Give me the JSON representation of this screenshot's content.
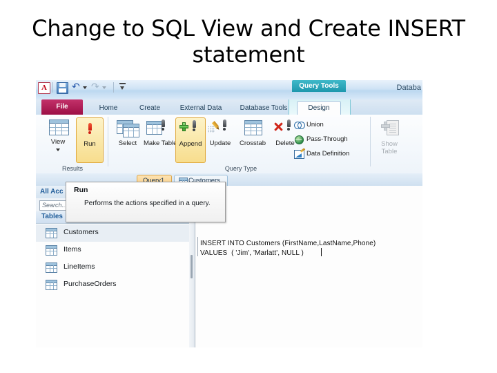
{
  "slide": {
    "title": "Change to SQL View and Create INSERT statement"
  },
  "app": {
    "window_title": "Databa",
    "logo_letter": "A",
    "contextual_group": "Query Tools",
    "quick_access": [
      {
        "name": "save-icon",
        "label": "Save"
      },
      {
        "name": "undo-icon",
        "label": "Undo"
      },
      {
        "name": "redo-icon",
        "label": "Redo"
      },
      {
        "name": "customize-qat-icon",
        "label": "Customize Quick Access Toolbar"
      }
    ]
  },
  "tabs": {
    "file": "File",
    "items": [
      "Home",
      "Create",
      "External Data",
      "Database Tools"
    ],
    "contextual": "Design"
  },
  "ribbon": {
    "groups": [
      {
        "label": "Results"
      },
      {
        "label": "Query Type"
      }
    ],
    "results": [
      {
        "label": "View",
        "icon": "datasheet-icon",
        "highlighted": false,
        "has_dropdown": true
      },
      {
        "label": "Run",
        "icon": "run-exclamation-icon",
        "highlighted": true,
        "has_dropdown": false
      }
    ],
    "query_type": [
      {
        "label": "Select",
        "icon": "select-query-icon",
        "highlighted": false
      },
      {
        "label": "Make Table",
        "icon": "make-table-query-icon",
        "highlighted": false
      },
      {
        "label": "Append",
        "icon": "append-query-icon",
        "highlighted": true
      },
      {
        "label": "Update",
        "icon": "update-query-icon",
        "highlighted": false
      },
      {
        "label": "Crosstab",
        "icon": "crosstab-query-icon",
        "highlighted": false
      },
      {
        "label": "Delete",
        "icon": "delete-query-icon",
        "highlighted": false
      }
    ],
    "query_type_menu": [
      {
        "label": "Union",
        "icon": "union-icon"
      },
      {
        "label": "Pass-Through",
        "icon": "globe-icon"
      },
      {
        "label": "Data Definition",
        "icon": "data-definition-icon"
      }
    ],
    "show_table": {
      "label_line1": "Show",
      "label_line2": "Table",
      "icon": "show-table-icon",
      "disabled": true
    }
  },
  "tooltip": {
    "title": "Run",
    "body": "Performs the actions specified in a query."
  },
  "document_tabs": [
    {
      "label": "Query1",
      "active": true,
      "icon": null
    },
    {
      "label": "Customers",
      "active": false,
      "icon": "table-icon"
    }
  ],
  "nav_pane": {
    "header": "All Acc",
    "search_placeholder": "Search...",
    "group_header": "Tables",
    "items": [
      {
        "label": "Customers",
        "icon": "table-icon",
        "selected": true
      },
      {
        "label": "Items",
        "icon": "table-icon",
        "selected": false
      },
      {
        "label": "LineItems",
        "icon": "table-icon",
        "selected": false
      },
      {
        "label": "PurchaseOrders",
        "icon": "table-icon",
        "selected": false
      }
    ]
  },
  "sql_pane": {
    "text": "INSERT INTO Customers (FirstName,LastName,Phone)\nVALUES  ( 'Jim', 'Marlatt', NULL )"
  },
  "colors": {
    "file_tab": "#a8174a",
    "highlight": "#f7dd8d",
    "highlight_border": "#e0a93d",
    "contextual": "#2da3b8",
    "nav_header_text": "#1f5c99"
  }
}
